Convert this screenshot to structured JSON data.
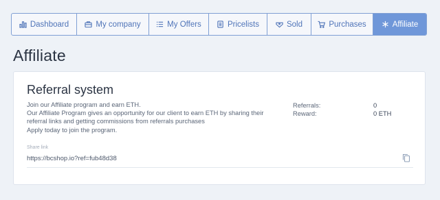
{
  "tabs": [
    {
      "label": "Dashboard",
      "icon": "bar-chart-icon",
      "active": false
    },
    {
      "label": "My company",
      "icon": "briefcase-icon",
      "active": false
    },
    {
      "label": "My Offers",
      "icon": "list-icon",
      "active": false
    },
    {
      "label": "Pricelists",
      "icon": "document-icon",
      "active": false
    },
    {
      "label": "Sold",
      "icon": "tag-icon",
      "active": false
    },
    {
      "label": "Purchases",
      "icon": "cart-icon",
      "active": false
    },
    {
      "label": "Affiliate",
      "icon": "asterisk-icon",
      "active": true
    }
  ],
  "page": {
    "title": "Affiliate"
  },
  "referral": {
    "title": "Referral system",
    "description": [
      "Join our Affiliate program and earn ETH.",
      "Our Affiliate Program gives an opportunity for our client to earn ETH by sharing their referral links and getting commissions from referrals purchases",
      "Apply today to join the program."
    ],
    "stats": {
      "referrals_label": "Referrals:",
      "referrals_value": "0",
      "reward_label": "Reward:",
      "reward_value": "0 ETH"
    },
    "share": {
      "label": "Share link",
      "value": "https://bcshop.io?ref=fub48d38",
      "copy_icon": "copy-icon"
    }
  },
  "colors": {
    "accent": "#6f97d9",
    "tab_text": "#4f74b8",
    "background": "#eef2f7"
  }
}
